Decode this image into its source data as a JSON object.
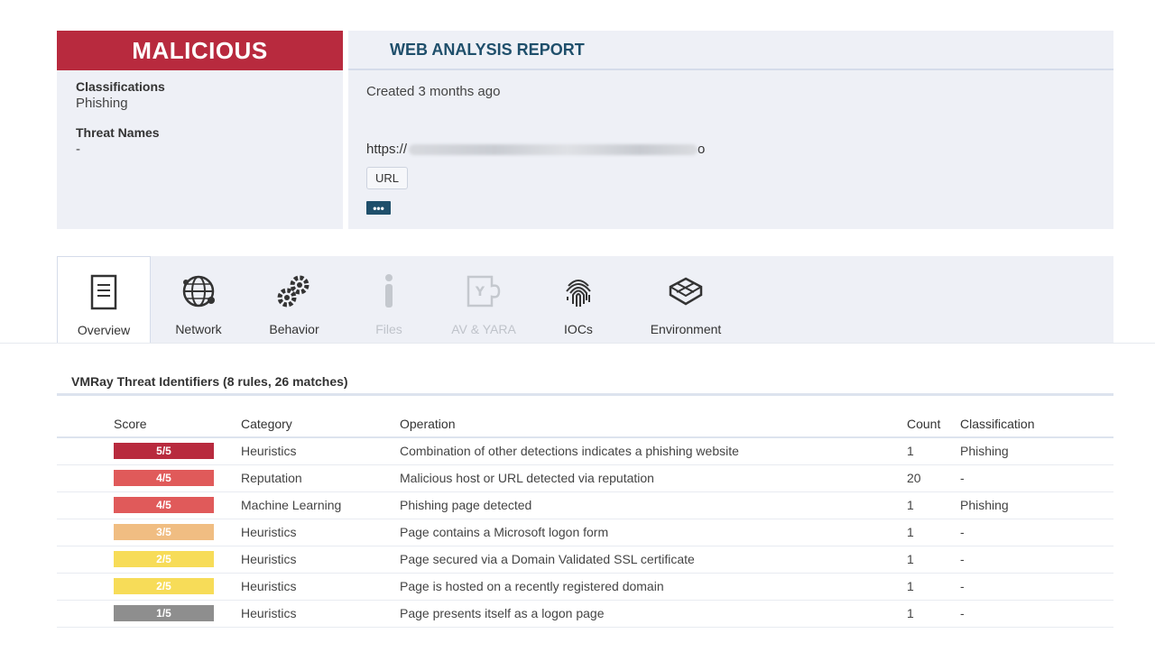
{
  "verdict": {
    "label": "MALICIOUS",
    "color": "#b82a3e"
  },
  "left_panel": {
    "classifications_label": "Classifications",
    "classifications_value": "Phishing",
    "threat_names_label": "Threat Names",
    "threat_names_value": "-"
  },
  "report": {
    "title": "WEB ANALYSIS REPORT",
    "created": "Created 3 months ago",
    "url_prefix": "https://",
    "url_suffix": "o",
    "url_type_badge": "URL",
    "more_label": "•••"
  },
  "tabs": [
    {
      "label": "Overview",
      "icon": "document-icon",
      "state": "active"
    },
    {
      "label": "Network",
      "icon": "globe-icon",
      "state": "normal"
    },
    {
      "label": "Behavior",
      "icon": "gears-icon",
      "state": "normal"
    },
    {
      "label": "Files",
      "icon": "info-icon",
      "state": "disabled"
    },
    {
      "label": "AV & YARA",
      "icon": "puzzle-icon",
      "state": "disabled"
    },
    {
      "label": "IOCs",
      "icon": "fingerprint-icon",
      "state": "normal"
    },
    {
      "label": "Environment",
      "icon": "cube-icon",
      "state": "normal"
    }
  ],
  "threat_identifiers": {
    "title": "VMRay Threat Identifiers (8 rules, 26 matches)",
    "columns": {
      "score": "Score",
      "category": "Category",
      "operation": "Operation",
      "count": "Count",
      "classification": "Classification"
    },
    "rows": [
      {
        "score": "5/5",
        "color": "#b82a3e",
        "category": "Heuristics",
        "operation": "Combination of other detections indicates a phishing website",
        "count": "1",
        "classification": "Phishing"
      },
      {
        "score": "4/5",
        "color": "#e05a5a",
        "category": "Reputation",
        "operation": "Malicious host or URL detected via reputation",
        "count": "20",
        "classification": "-"
      },
      {
        "score": "4/5",
        "color": "#e05a5a",
        "category": "Machine Learning",
        "operation": "Phishing page detected",
        "count": "1",
        "classification": "Phishing"
      },
      {
        "score": "3/5",
        "color": "#f0bd82",
        "category": "Heuristics",
        "operation": "Page contains a Microsoft logon form",
        "count": "1",
        "classification": "-"
      },
      {
        "score": "2/5",
        "color": "#f7dc58",
        "category": "Heuristics",
        "operation": "Page secured via a Domain Validated SSL certificate",
        "count": "1",
        "classification": "-"
      },
      {
        "score": "2/5",
        "color": "#f7dc58",
        "category": "Heuristics",
        "operation": "Page is hosted on a recently registered domain",
        "count": "1",
        "classification": "-"
      },
      {
        "score": "1/5",
        "color": "#8e8e8e",
        "category": "Heuristics",
        "operation": "Page presents itself as a logon page",
        "count": "1",
        "classification": "-"
      }
    ]
  }
}
